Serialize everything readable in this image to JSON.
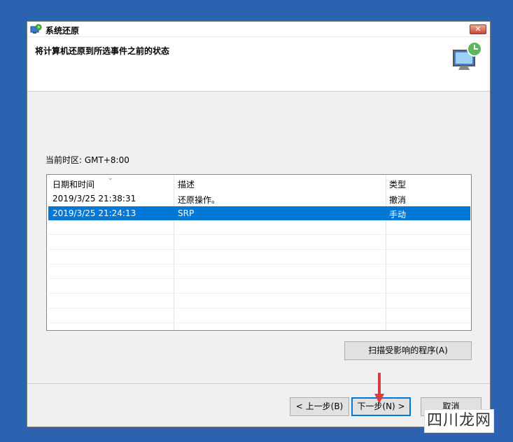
{
  "window": {
    "title": "系统还原",
    "close_label": "✕",
    "header_title": "将计算机还原到所选事件之前的状态"
  },
  "timezone_label": "当前时区: GMT+8:00",
  "table": {
    "columns": [
      "日期和时间",
      "描述",
      "类型"
    ],
    "rows": [
      {
        "date": "2019/3/25 21:38:31",
        "desc": "还原操作。",
        "type": "撤消",
        "selected": false
      },
      {
        "date": "2019/3/25 21:24:13",
        "desc": "SRP",
        "type": "手动",
        "selected": true
      }
    ]
  },
  "buttons": {
    "scan": "扫描受影响的程序(A)",
    "back": "< 上一步(B)",
    "next": "下一步(N) >",
    "cancel": "取消"
  },
  "icons": {
    "title_icon": "system-restore-icon",
    "header_icon": "monitor-restore-icon",
    "annotation": "red-down-arrow"
  },
  "watermark": "四川龙网",
  "colors": {
    "desktop": "#2b63b0",
    "selection": "#0078d7",
    "arrow": "#e0393e"
  }
}
